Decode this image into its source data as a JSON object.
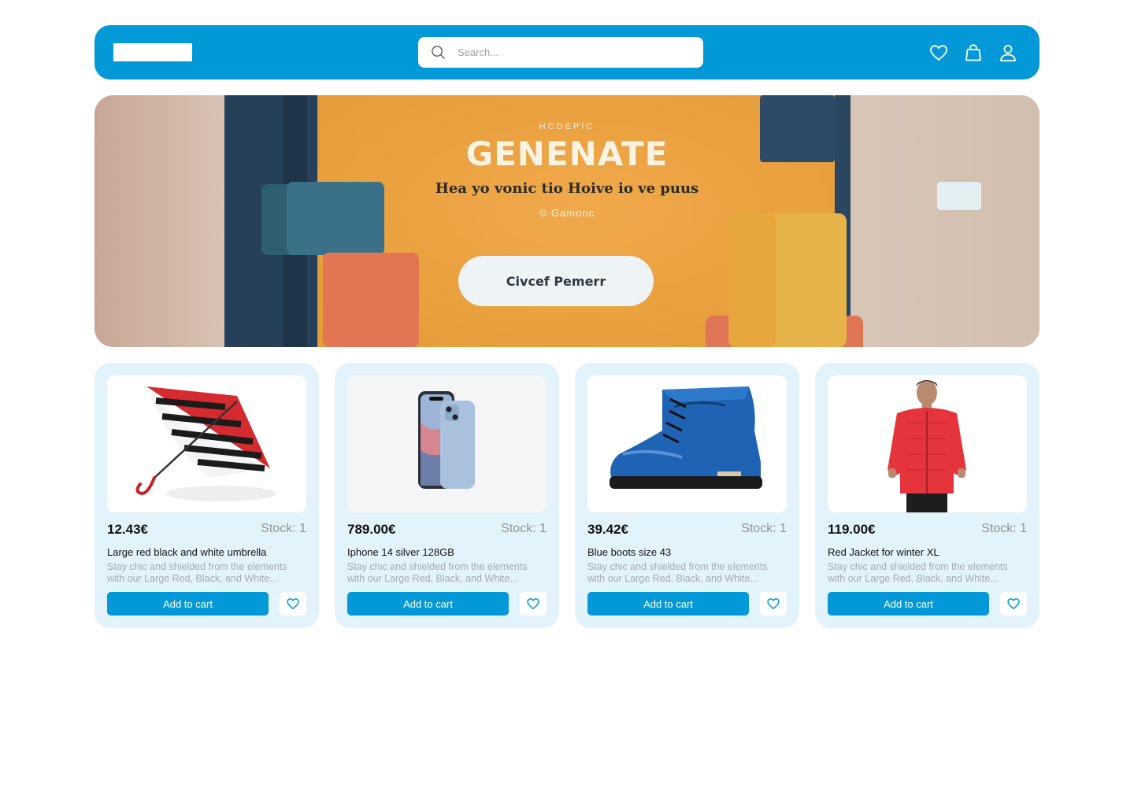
{
  "header": {
    "search_placeholder": "Search...",
    "icons": [
      "heart-icon",
      "shopping-bag-icon",
      "user-icon"
    ],
    "background": "#0399d9"
  },
  "hero": {
    "kicker": "HCDEPIC",
    "title": "GENENATE",
    "subtitle": "Hea yo vonic tio Hoive io ve puus",
    "small_text": "© Gamonc",
    "button_label": "Civcef Pemerr"
  },
  "products": [
    {
      "price": "12.43€",
      "stock": "Stock: 1",
      "name": "Large red black and white umbrella",
      "description": "Stay chic and shielded from the elements with our Large Red, Black, and White...",
      "add_to_cart": "Add to cart",
      "image": "umbrella"
    },
    {
      "price": "789.00€",
      "stock": "Stock: 1",
      "name": "Iphone 14 silver 128GB",
      "description": "Stay chic and shielded from the elements with our Large Red, Black, and White...",
      "add_to_cart": "Add to cart",
      "image": "phone"
    },
    {
      "price": "39.42€",
      "stock": "Stock: 1",
      "name": "Blue boots size 43",
      "description": "Stay chic and shielded from the elements with our Large Red, Black, and White...",
      "add_to_cart": "Add to cart",
      "image": "boot"
    },
    {
      "price": "119.00€",
      "stock": "Stock: 1",
      "name": "Red Jacket for winter XL",
      "description": "Stay chic and shielded from the elements with our Large Red, Black, and White...",
      "add_to_cart": "Add to cart",
      "image": "jacket"
    }
  ],
  "colors": {
    "primary": "#0399d9",
    "card_bg": "#e3f3fc",
    "muted_text": "#a3abb3"
  }
}
